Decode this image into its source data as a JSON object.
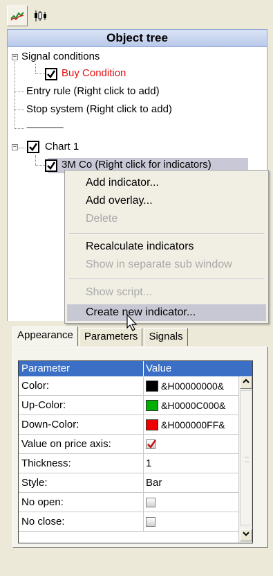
{
  "toolbar": {
    "buttons": [
      {
        "icon": "signals-icon"
      },
      {
        "icon": "candles-icon"
      }
    ]
  },
  "object_tree": {
    "title": "Object tree",
    "signal_conditions": "Signal conditions",
    "buy_condition": "Buy Condition",
    "entry_rule": "Entry rule (Right click to add)",
    "stop_system": "Stop system (Right click to add)",
    "separator": "--------------------",
    "chart": "Chart 1",
    "security": "3M Co (Right click for indicators)"
  },
  "context_menu": {
    "add_indicator": "Add indicator...",
    "add_overlay": "Add overlay...",
    "delete": "Delete",
    "recalculate": "Recalculate indicators",
    "show_separate": "Show in separate sub window",
    "show_script": "Show script...",
    "create_indicator": "Create new indicator..."
  },
  "tabs": {
    "appearance": "Appearance",
    "parameters": "Parameters",
    "signals": "Signals"
  },
  "grid": {
    "col_parameter": "Parameter",
    "col_value": "Value",
    "rows": [
      {
        "name": "Color:",
        "value": "&H00000000&",
        "swatch": "#000000"
      },
      {
        "name": "Up-Color:",
        "value": "&H0000C000&",
        "swatch": "#00b000"
      },
      {
        "name": "Down-Color:",
        "value": "&H000000FF&",
        "swatch": "#ee0000"
      },
      {
        "name": "Value on price axis:",
        "value": "",
        "checked": true
      },
      {
        "name": "Thickness:",
        "value": "1"
      },
      {
        "name": "Style:",
        "value": "Bar"
      },
      {
        "name": "No open:",
        "value": "",
        "checked": false
      },
      {
        "name": "No close:",
        "value": "",
        "checked": false
      }
    ]
  },
  "colors": {
    "accent_header": "#3b6fc5",
    "buy_red": "#e01010",
    "menu_hover": "#c8c8d4"
  }
}
